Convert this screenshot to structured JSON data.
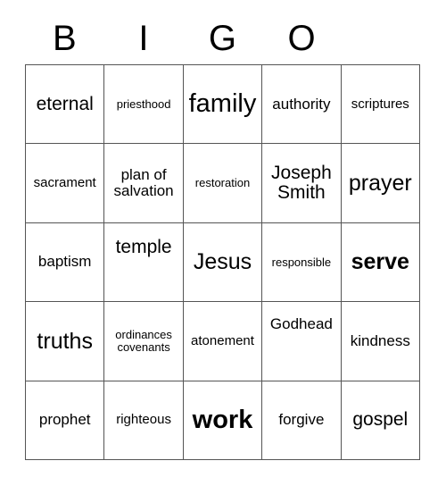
{
  "card": {
    "title_letters": [
      "B",
      "I",
      "G",
      "O",
      ""
    ],
    "columns": 5,
    "rows": 5,
    "border_color": "#555555",
    "text_color": "#000000",
    "background_color": "#ffffff",
    "cells": [
      [
        {
          "text": "eternal",
          "size": "fs-l",
          "bold": false,
          "high": false
        },
        {
          "text": "priesthood",
          "size": "fs-xs",
          "bold": false,
          "high": false
        },
        {
          "text": "family",
          "size": "fs-xxl",
          "bold": false,
          "high": false
        },
        {
          "text": "authority",
          "size": "fs-m",
          "bold": false,
          "high": false
        },
        {
          "text": "scriptures",
          "size": "fs-s",
          "bold": false,
          "high": false
        }
      ],
      [
        {
          "text": "sacrament",
          "size": "fs-s",
          "bold": false,
          "high": false
        },
        {
          "text": "plan of\nsalvation",
          "size": "fs-m",
          "bold": false,
          "high": false
        },
        {
          "text": "restoration",
          "size": "fs-xs",
          "bold": false,
          "high": false
        },
        {
          "text": "Joseph\nSmith",
          "size": "fs-l",
          "bold": false,
          "high": false
        },
        {
          "text": "prayer",
          "size": "fs-xl",
          "bold": false,
          "high": false
        }
      ],
      [
        {
          "text": "baptism",
          "size": "fs-m",
          "bold": false,
          "high": false
        },
        {
          "text": "temple",
          "size": "fs-l",
          "bold": false,
          "high": true
        },
        {
          "text": "Jesus",
          "size": "fs-xl",
          "bold": false,
          "high": false
        },
        {
          "text": "responsible",
          "size": "fs-xs",
          "bold": false,
          "high": false
        },
        {
          "text": "serve",
          "size": "fs-xl",
          "bold": true,
          "high": false
        }
      ],
      [
        {
          "text": "truths",
          "size": "fs-xl",
          "bold": false,
          "high": false
        },
        {
          "text": "ordinances\ncovenants",
          "size": "fs-xs",
          "bold": false,
          "high": false
        },
        {
          "text": "atonement",
          "size": "fs-s",
          "bold": false,
          "high": false
        },
        {
          "text": "Godhead",
          "size": "fs-m",
          "bold": false,
          "high": true
        },
        {
          "text": "kindness",
          "size": "fs-m",
          "bold": false,
          "high": false
        }
      ],
      [
        {
          "text": "prophet",
          "size": "fs-m",
          "bold": false,
          "high": false
        },
        {
          "text": "righteous",
          "size": "fs-s",
          "bold": false,
          "high": false
        },
        {
          "text": "work",
          "size": "fs-xxl",
          "bold": true,
          "high": false
        },
        {
          "text": "forgive",
          "size": "fs-m",
          "bold": false,
          "high": false
        },
        {
          "text": "gospel",
          "size": "fs-l",
          "bold": false,
          "high": false
        }
      ]
    ]
  }
}
